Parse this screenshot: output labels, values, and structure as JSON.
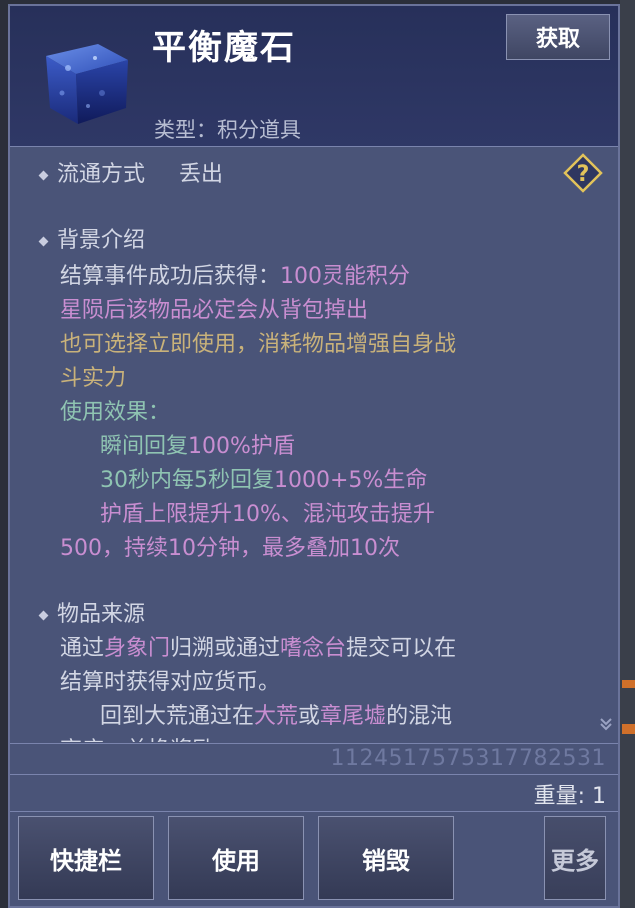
{
  "item": {
    "name": "平衡魔石",
    "type_label": "类型：积分道具",
    "get_button": "获取"
  },
  "circulation": {
    "label": "流通方式",
    "value": "丢出"
  },
  "background": {
    "heading": "背景介绍",
    "line1_a": "结算事件成功后获得：",
    "line1_b": "100灵能积分",
    "line2": "星陨后该物品必定会从背包掉出",
    "line3": "也可选择立即使用，消耗物品增强自身战",
    "line4": "斗实力",
    "effect_heading": "使用效果：",
    "effect1_a": "瞬间回复",
    "effect1_b": "100%护盾",
    "effect2_a": "30秒内每5秒回复",
    "effect2_b": "1000+5%生命",
    "effect3": "护盾上限提升10%、混沌攻击提升",
    "effect4": "500，持续10分钟，最多叠加10次"
  },
  "source": {
    "heading": "物品来源",
    "line1_a": "通过",
    "line1_b": "身象门",
    "line1_c": "归溯或通过",
    "line1_d": "嗜念台",
    "line1_e": "提交可以在",
    "line2": "结算时获得对应货币。",
    "line3_a": "回到大荒通过在",
    "line3_b": "大荒",
    "line3_c": "或",
    "line3_d": "章尾墟",
    "line3_e": "的混沌",
    "line4": "商店，兑换奖励"
  },
  "id_number": "112451757531778253​1",
  "weight": "重量: 1",
  "buttons": {
    "shortcut": "快捷栏",
    "use": "使用",
    "destroy": "销毁",
    "more": "更多"
  }
}
